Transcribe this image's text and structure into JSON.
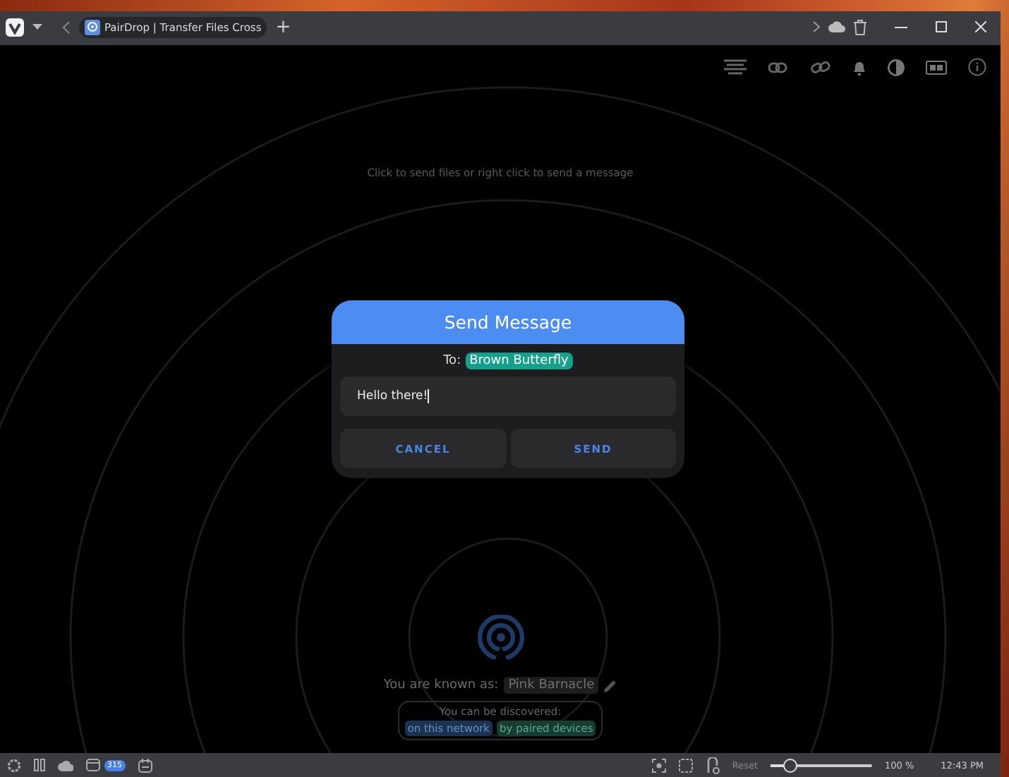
{
  "browser": {
    "tab_title": "PairDrop | Transfer Files Cross",
    "new_tab": "+"
  },
  "hint": "Click to send files or right click to send a message",
  "dialog": {
    "title": "Send Message",
    "to_label": "To:",
    "recipient": "Brown Butterfly",
    "message": "Hello there!",
    "buttons": [
      {
        "label": "CANCEL"
      },
      {
        "label": "SEND"
      }
    ]
  },
  "self": {
    "known_as_label": "You are known as:",
    "name": "Pink Barnacle",
    "discover_label": "You can be discovered:",
    "discovery": [
      {
        "label": "on this network",
        "color": "#1b3352"
      },
      {
        "label": "by paired devices",
        "color": "#163d33"
      }
    ]
  },
  "status_bar": {
    "mail_count": "315",
    "zoom_reset": "Reset",
    "zoom": {
      "level": 0.2
    },
    "zoom_reading": "100 %",
    "clock": "12:43 PM"
  }
}
